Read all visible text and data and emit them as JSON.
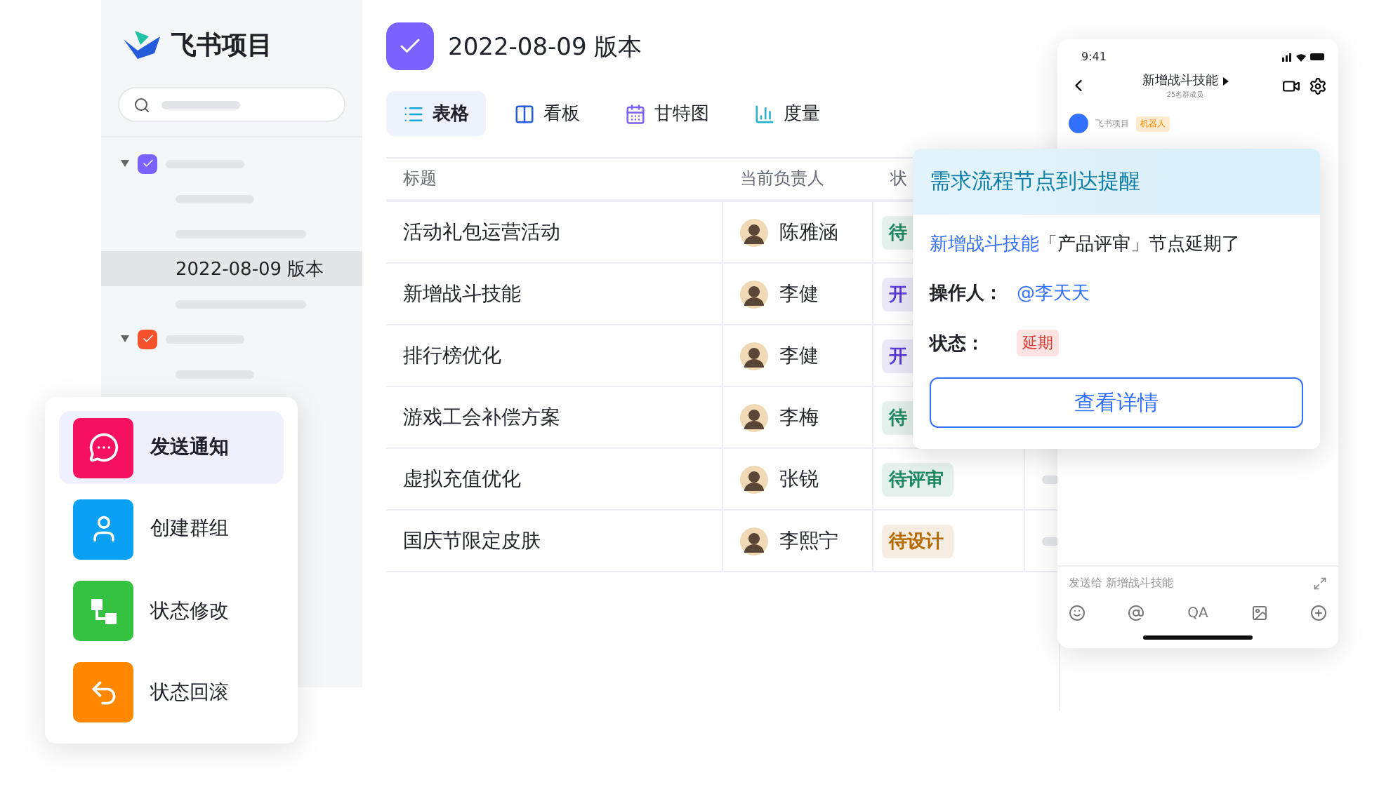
{
  "sidebar": {
    "brand": "飞书项目",
    "search": {
      "kind": "skeleton"
    },
    "tree": [
      {
        "kind": "group",
        "color": "#7b61ff",
        "expanded": true,
        "children": [
          {
            "kind": "skeleton",
            "selected": false
          },
          {
            "kind": "skeleton",
            "selected": false
          },
          {
            "kind": "text",
            "label": "2022-08-09 版本",
            "selected": true
          },
          {
            "kind": "skeleton",
            "selected": false
          }
        ]
      },
      {
        "kind": "group",
        "color": "#f5522d",
        "expanded": true,
        "children": [
          {
            "kind": "skeleton",
            "selected": false
          }
        ]
      }
    ]
  },
  "header": {
    "title": "2022-08-09 版本"
  },
  "tabs": [
    {
      "kind": "table",
      "label": "表格",
      "selected": true
    },
    {
      "kind": "board",
      "label": "看板",
      "selected": false
    },
    {
      "kind": "gantt",
      "label": "甘特图",
      "selected": false
    },
    {
      "kind": "metrics",
      "label": "度量",
      "selected": false
    }
  ],
  "table": {
    "columns": [
      "标题",
      "当前负责人",
      "状"
    ],
    "rows": [
      {
        "title": "活动礼包运营活动",
        "owner": "陈雅涵",
        "status": {
          "text": "待",
          "color": "#1f8a62"
        }
      },
      {
        "title": "新增战斗技能",
        "owner": "李健",
        "status": {
          "text": "开",
          "color": "#5b3ed6"
        }
      },
      {
        "title": "排行榜优化",
        "owner": "李健",
        "status": {
          "text": "开",
          "color": "#5b3ed6"
        }
      },
      {
        "title": "游戏工会补偿方案",
        "owner": "李梅",
        "status": {
          "text": "待",
          "color": "#1f8a62"
        }
      },
      {
        "title": "虚拟充值优化",
        "owner": "张锐",
        "status": {
          "text": "待评审",
          "color": "#1f8a62"
        }
      },
      {
        "title": "国庆节限定皮肤",
        "owner": "李熙宁",
        "status": {
          "text": "待设计",
          "color": "#b56a00"
        }
      }
    ]
  },
  "actions": [
    {
      "kind": "chat",
      "color": "#f5115f",
      "label": "发送通知",
      "selected": true
    },
    {
      "kind": "user",
      "color": "#0aa1f5",
      "label": "创建群组",
      "selected": false
    },
    {
      "kind": "flow",
      "color": "#34c240",
      "label": "状态修改",
      "selected": false
    },
    {
      "kind": "undo",
      "color": "#ff8800",
      "label": "状态回滚",
      "selected": false
    }
  ],
  "phone": {
    "time": "9:41",
    "chat_title": "新增战斗技能",
    "members": "25名群成员",
    "bot_name": "飞书项目",
    "bot_tag": "机器人",
    "input_placeholder": "发送给 新增战斗技能",
    "qa": "QA"
  },
  "notification": {
    "title": "需求流程节点到达提醒",
    "link": "新增战斗技能",
    "message": "「产品评审」节点延期了",
    "operator_label": "操作人：",
    "operator": "@李天天",
    "status_label": "状态：",
    "status": "延期",
    "button": "查看详情"
  }
}
